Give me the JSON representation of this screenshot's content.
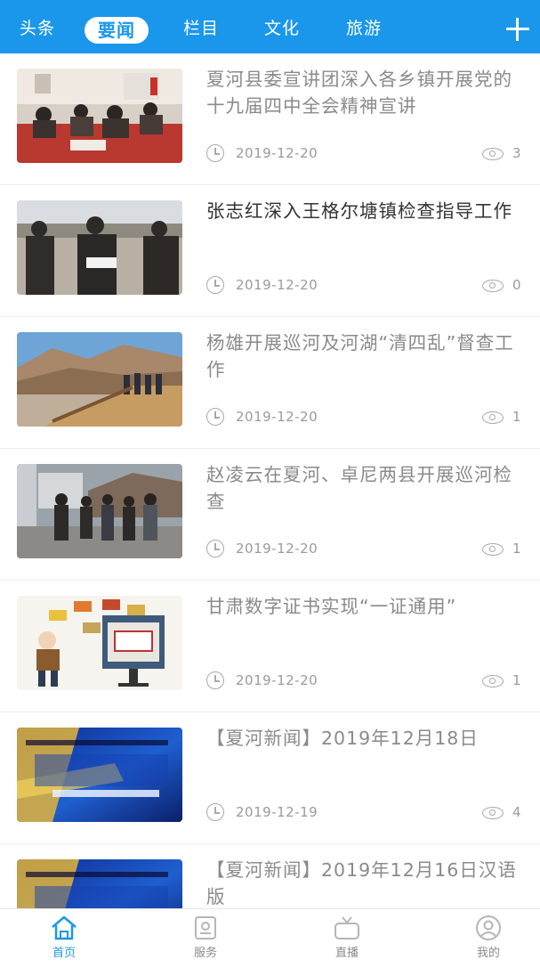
{
  "topbar": {
    "tabs": [
      "头条",
      "要闻",
      "栏目",
      "文化",
      "旅游"
    ],
    "active_index": 1,
    "add_icon": "plus-icon"
  },
  "news": [
    {
      "title": "夏河县委宣讲团深入各乡镇开展党的十九届四中全会精神宣讲",
      "date": "2019-12-20",
      "views": "3",
      "thumb": "meeting-photo"
    },
    {
      "title": "张志红深入王格尔塘镇检查指导工作",
      "date": "2019-12-20",
      "views": "0",
      "thumb": "officials-inspection-photo"
    },
    {
      "title": "杨雄开展巡河及河湖“清四乱”督查工作",
      "date": "2019-12-20",
      "views": "1",
      "thumb": "river-bridge-photo"
    },
    {
      "title": "赵凌云在夏河、卓尼两县开展巡河检查",
      "date": "2019-12-20",
      "views": "1",
      "thumb": "river-patrol-photo"
    },
    {
      "title": "甘肃数字证书实现“一证通用”",
      "date": "2019-12-20",
      "views": "1",
      "thumb": "digital-certificate-illustration"
    },
    {
      "title": "【夏河新闻】2019年12月18日",
      "date": "2019-12-19",
      "views": "4",
      "thumb": "xiahe-news-logo"
    },
    {
      "title": "【夏河新闻】2019年12月16日汉语版",
      "date": "",
      "views": "",
      "thumb": "xiahe-news-logo"
    }
  ],
  "bottom_tabs": [
    {
      "label": "首页",
      "icon": "home-icon",
      "active": true
    },
    {
      "label": "服务",
      "icon": "service-icon",
      "active": false
    },
    {
      "label": "直播",
      "icon": "live-icon",
      "active": false
    },
    {
      "label": "我的",
      "icon": "profile-icon",
      "active": false
    }
  ],
  "colors": {
    "accent": "#1a97ea",
    "text_dark": "#333333",
    "text_muted": "#8a8a8a"
  }
}
